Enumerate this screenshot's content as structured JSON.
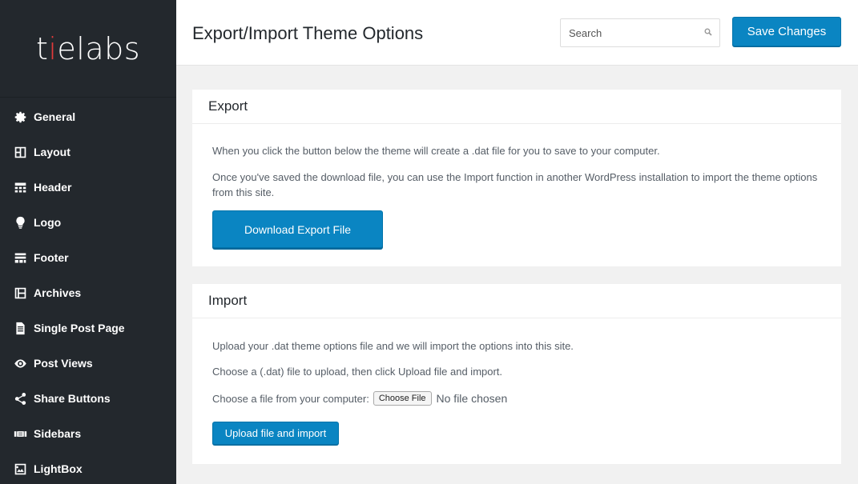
{
  "brand": {
    "logo_text_part1": "t",
    "logo_text_accent": "i",
    "logo_text_part2": "elabs"
  },
  "sidebar": {
    "items": [
      {
        "label": "General",
        "icon": "gear-icon"
      },
      {
        "label": "Layout",
        "icon": "layout-icon"
      },
      {
        "label": "Header",
        "icon": "header-icon"
      },
      {
        "label": "Logo",
        "icon": "lightbulb-icon"
      },
      {
        "label": "Footer",
        "icon": "footer-icon"
      },
      {
        "label": "Archives",
        "icon": "archives-icon"
      },
      {
        "label": "Single Post Page",
        "icon": "document-icon"
      },
      {
        "label": "Post Views",
        "icon": "eye-icon"
      },
      {
        "label": "Share Buttons",
        "icon": "share-icon"
      },
      {
        "label": "Sidebars",
        "icon": "sidebars-icon"
      },
      {
        "label": "LightBox",
        "icon": "image-icon"
      }
    ]
  },
  "header": {
    "title": "Export/Import Theme Options",
    "search_placeholder": "Search",
    "save_label": "Save Changes"
  },
  "export": {
    "title": "Export",
    "text1": "When you click the button below the theme will create a .dat file for you to save to your computer.",
    "text2": "Once you've saved the download file, you can use the Import function in another WordPress installation to import the theme options from this site.",
    "button_label": "Download Export File"
  },
  "import": {
    "title": "Import",
    "text1": "Upload your .dat theme options file and we will import the options into this site.",
    "text2": "Choose a (.dat) file to upload, then click Upload file and import.",
    "file_label": "Choose a file from your computer:",
    "choose_button": "Choose File",
    "no_file_text": "No file chosen",
    "upload_button": "Upload file and import"
  },
  "colors": {
    "sidebar_bg": "#23282d",
    "primary_button": "#0a85c2",
    "accent_logo": "#e23a3a"
  }
}
